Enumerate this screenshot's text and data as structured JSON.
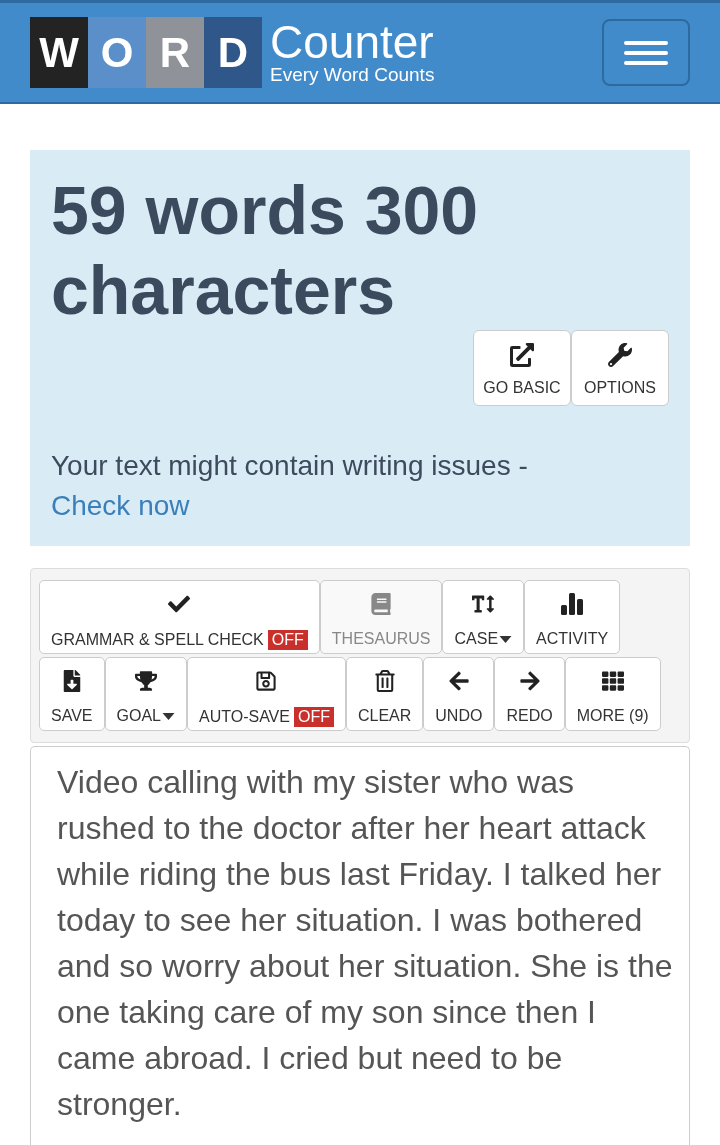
{
  "header": {
    "logo_letters": [
      "W",
      "O",
      "R",
      "D"
    ],
    "logo_title": "Counter",
    "logo_tagline": "Every Word Counts"
  },
  "stats": {
    "headline": "59 words 300 characters",
    "actions": [
      {
        "label": "GO BASIC"
      },
      {
        "label": "OPTIONS"
      }
    ],
    "notice": {
      "text": "Your text might contain writing issues -",
      "link": "Check now"
    }
  },
  "toolbar": {
    "buttons": [
      {
        "label": "GRAMMAR & SPELL CHECK",
        "badge": "OFF",
        "disabled": false,
        "dropdown": false
      },
      {
        "label": "THESAURUS",
        "disabled": true,
        "dropdown": false
      },
      {
        "label": "CASE",
        "disabled": false,
        "dropdown": true
      },
      {
        "label": "ACTIVITY",
        "disabled": false,
        "dropdown": false
      },
      {
        "label": "SAVE",
        "disabled": false,
        "dropdown": false
      },
      {
        "label": "GOAL",
        "disabled": false,
        "dropdown": true
      },
      {
        "label": "AUTO-SAVE",
        "badge": "OFF",
        "disabled": false,
        "dropdown": false
      },
      {
        "label": "CLEAR",
        "disabled": false,
        "dropdown": false
      },
      {
        "label": "UNDO",
        "disabled": false,
        "dropdown": false
      },
      {
        "label": "REDO",
        "disabled": false,
        "dropdown": false
      },
      {
        "label": "MORE (9)",
        "disabled": false,
        "dropdown": false
      }
    ]
  },
  "editor": {
    "value": "Video calling with my sister who was rushed to the doctor after her heart attack while riding the bus last Friday. I talked her today to see her situation. I was bothered and so worry about her situation. She is the one taking care of my son since then I came abroad. I cried but need to be stronger."
  }
}
